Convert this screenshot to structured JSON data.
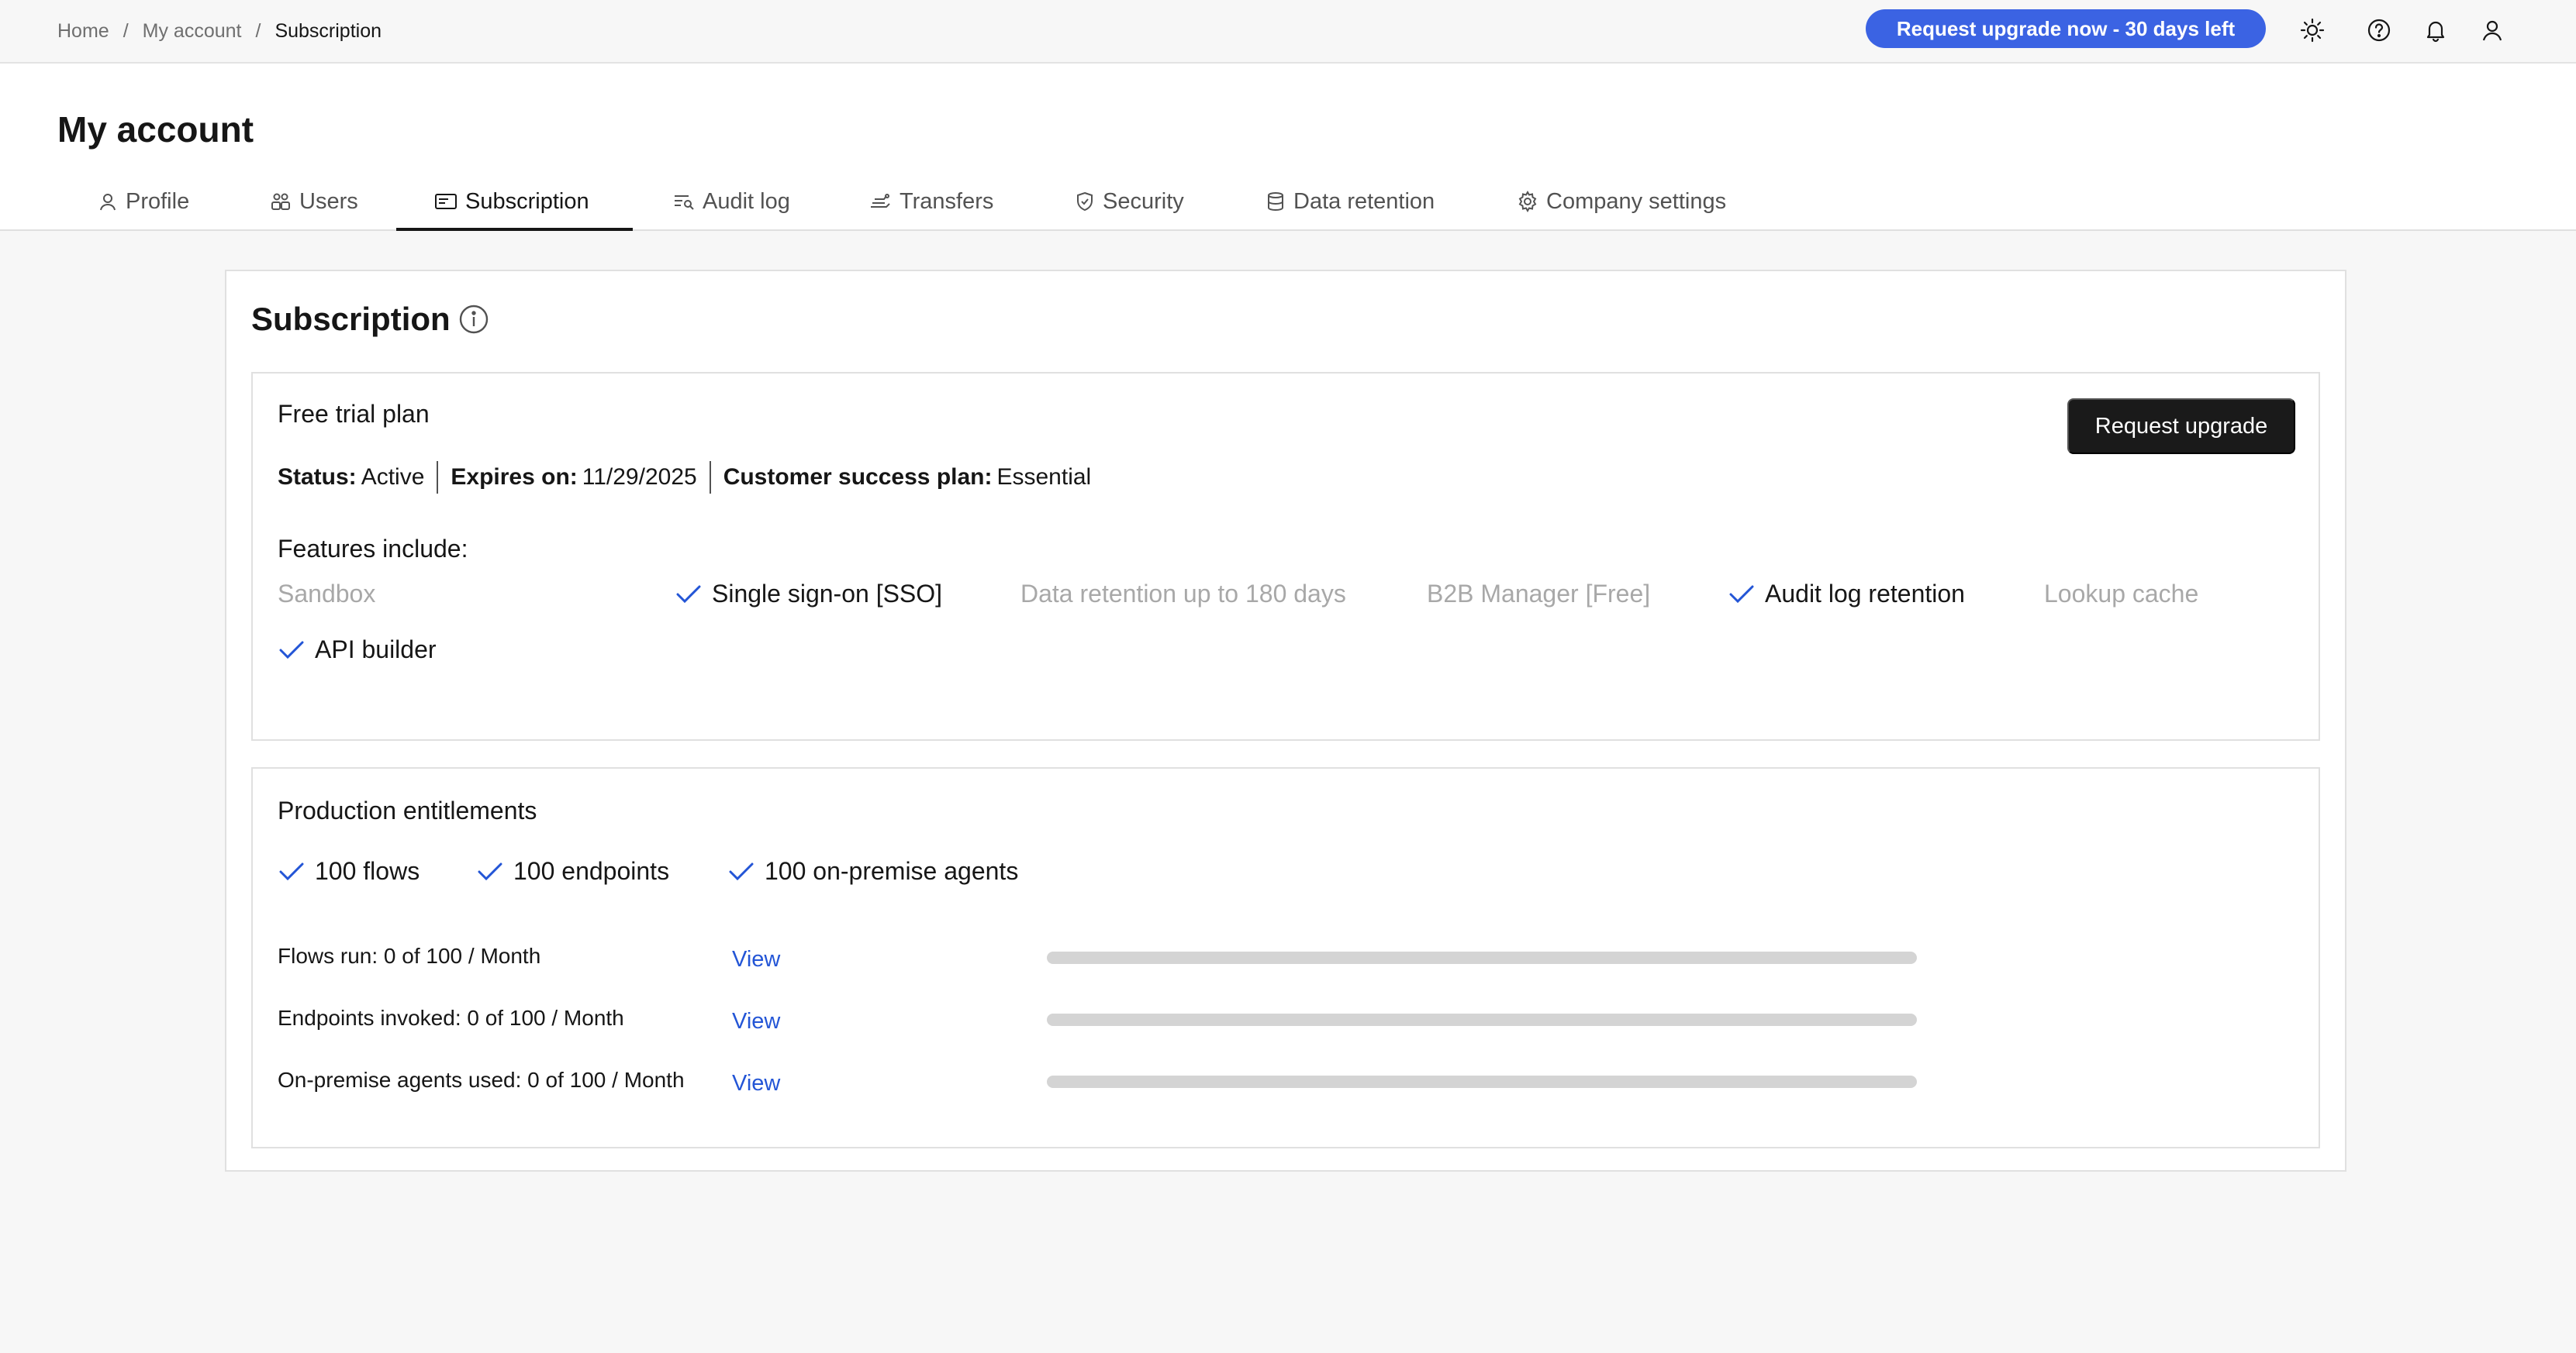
{
  "breadcrumb": {
    "home": "Home",
    "account": "My account",
    "current": "Subscription",
    "separator": "/"
  },
  "topbar": {
    "upgrade_pill": "Request upgrade now - 30 days left",
    "icons": [
      "sun-icon",
      "help-icon",
      "bell-icon",
      "user-icon"
    ]
  },
  "page": {
    "title": "My account"
  },
  "tabs": [
    {
      "label": "Profile",
      "icon": "user-icon"
    },
    {
      "label": "Users",
      "icon": "users-icon"
    },
    {
      "label": "Subscription",
      "icon": "card-icon",
      "active": true
    },
    {
      "label": "Audit log",
      "icon": "audit-log-icon"
    },
    {
      "label": "Transfers",
      "icon": "transfers-icon"
    },
    {
      "label": "Security",
      "icon": "shield-icon"
    },
    {
      "label": "Data retention",
      "icon": "database-icon"
    },
    {
      "label": "Company settings",
      "icon": "gear-icon"
    }
  ],
  "subscription": {
    "title": "Subscription",
    "plan": {
      "name": "Free trial plan",
      "status_label": "Status:",
      "status_value": "Active",
      "expires_label": "Expires on:",
      "expires_value": "11/29/2025",
      "csp_label": "Customer success plan:",
      "csp_value": "Essential",
      "upgrade_button": "Request upgrade",
      "features_label": "Features include:",
      "features": [
        {
          "label": "Sandbox",
          "included": false
        },
        {
          "label": "Single sign-on [SSO]",
          "included": true
        },
        {
          "label": "Data retention up to 180 days",
          "included": false
        },
        {
          "label": "B2B Manager [Free]",
          "included": false
        },
        {
          "label": "Audit log retention",
          "included": true
        },
        {
          "label": "Lookup cache",
          "included": false
        },
        {
          "label": "API builder",
          "included": true
        }
      ]
    },
    "entitlements": {
      "title": "Production entitlements",
      "items": [
        "100 flows",
        "100 endpoints",
        "100 on-premise agents"
      ],
      "usage": [
        {
          "label": "Flows run: 0 of 100 / Month",
          "link": "View",
          "used_fraction": 0
        },
        {
          "label": "Endpoints invoked: 0 of 100 / Month",
          "link": "View",
          "used_fraction": 0
        },
        {
          "label": "On-premise agents used: 0 of 100 / Month",
          "link": "View",
          "used_fraction": 0
        }
      ]
    }
  },
  "colors": {
    "accent": "#3b63e3",
    "link": "#2355d6",
    "check": "#2355d6",
    "dark_button": "#1a1a1a",
    "disabled_text": "#a8a8a8"
  }
}
